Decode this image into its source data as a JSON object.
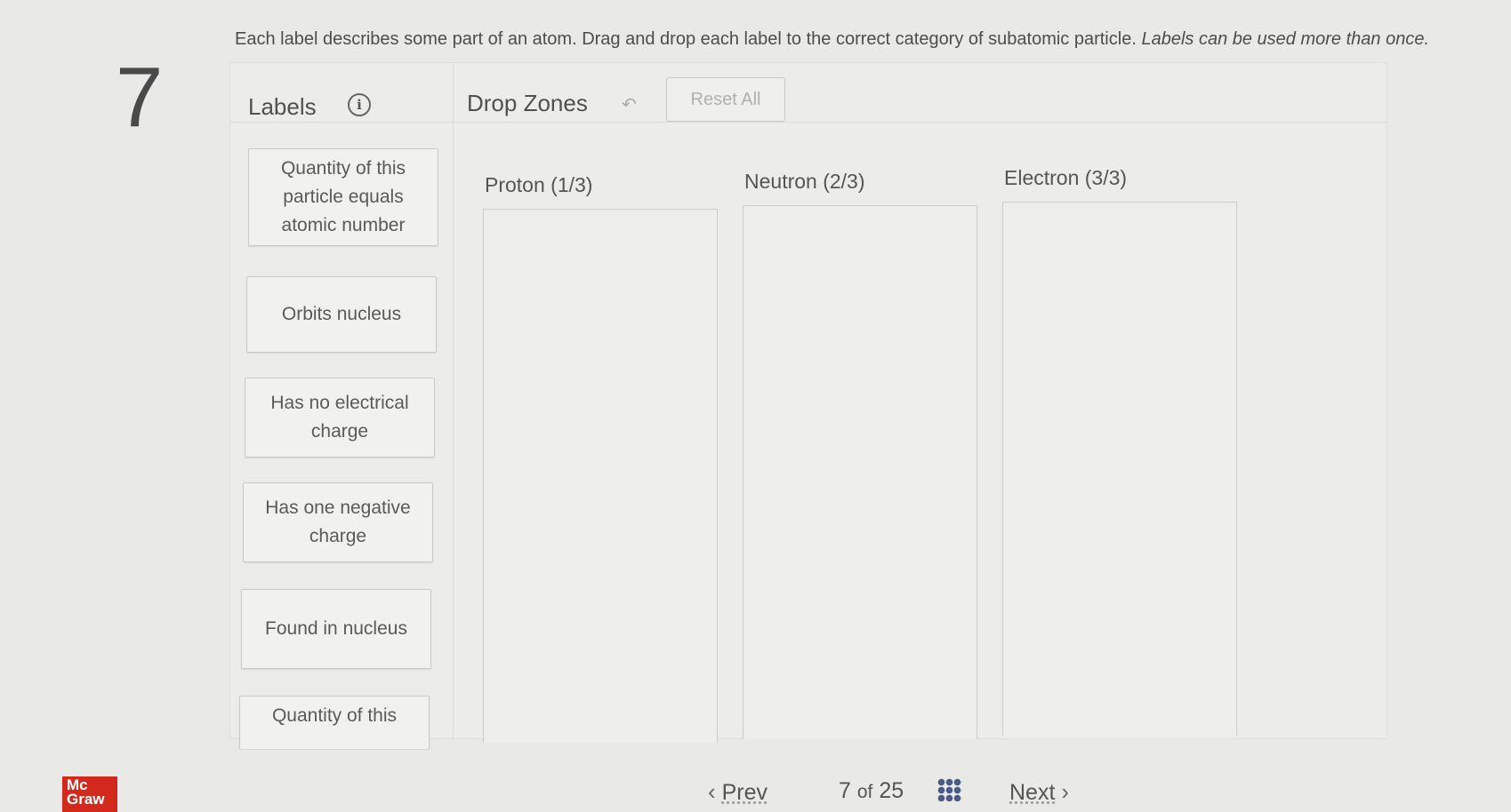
{
  "question": {
    "number": "7",
    "instructions": "Each label describes some part of an atom. Drag and drop each label to the correct category of subatomic particle.",
    "instructions_italic": "Labels can be used more than once."
  },
  "panel": {
    "labels_title": "Labels",
    "info_icon": "info-icon",
    "drop_zones_title": "Drop Zones",
    "undo_icon": "undo-arrow-icon",
    "reset_label": "Reset All"
  },
  "labels": [
    "Quantity of this particle equals atomic number",
    "Orbits nucleus",
    "Has no electrical charge",
    "Has one negative charge",
    "Found in nucleus",
    "Quantity of this"
  ],
  "zones": [
    {
      "title": "Proton (1/3)"
    },
    {
      "title": "Neutron (2/3)"
    },
    {
      "title": "Electron (3/3)"
    }
  ],
  "footer": {
    "logo_text": "Mc Graw",
    "prev_label": "Prev",
    "page_current": "7",
    "page_of": "of",
    "page_total": "25",
    "grid_icon": "question-grid-icon",
    "next_label": "Next"
  },
  "colors": {
    "background": "#e9e9e7",
    "logo": "#d3291c",
    "grid_icon": "#4a5a88"
  }
}
